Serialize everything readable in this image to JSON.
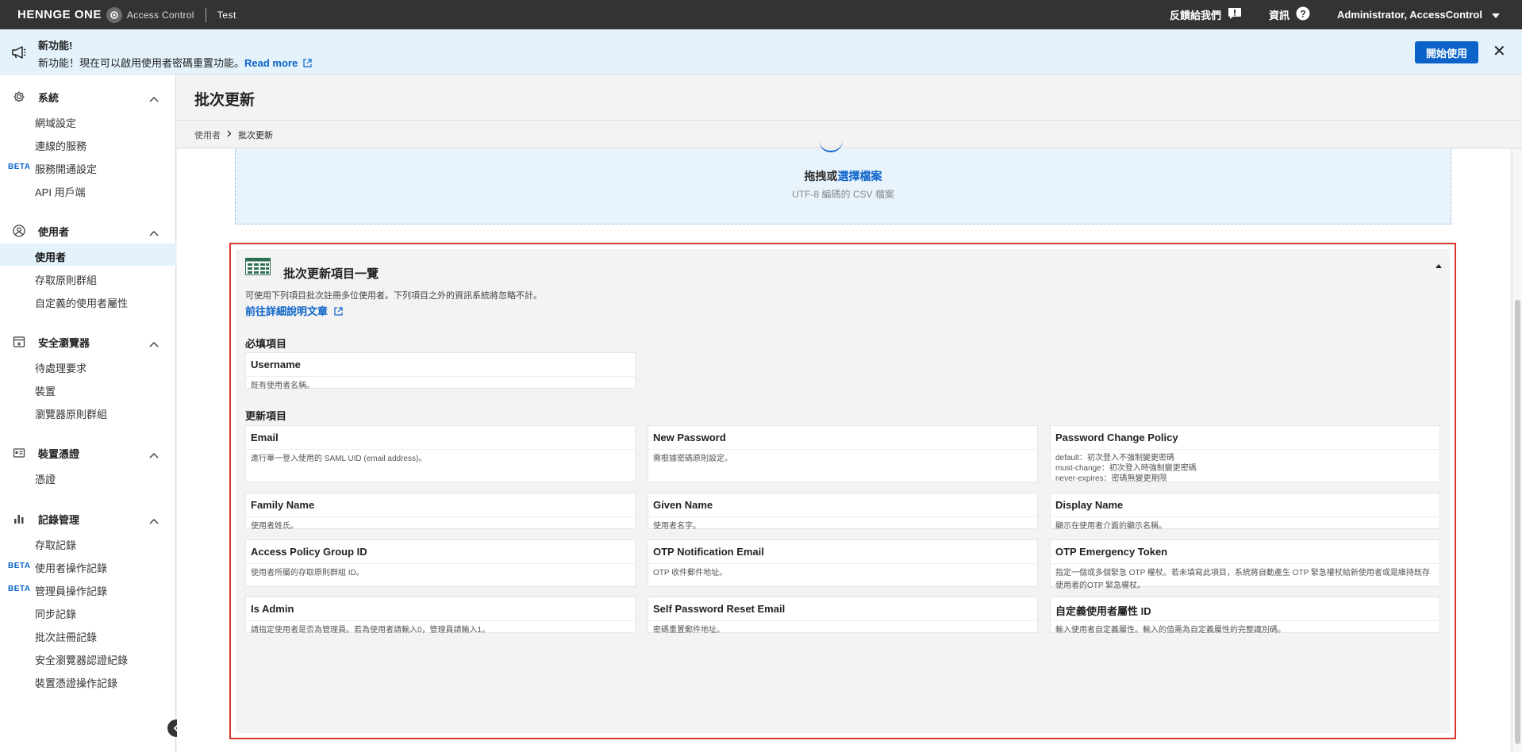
{
  "topbar": {
    "brand": "HENNGE ONE",
    "product": "Access Control",
    "tenant": "Test",
    "feedback": "反饋給我們",
    "info": "資訊",
    "user": "Administrator, AccessControl"
  },
  "banner": {
    "title": "新功能!",
    "text": "新功能！現在可以啟用使用者密碼重置功能。",
    "link": "Read more",
    "start_button": "開始使用"
  },
  "sidebar": {
    "beta": "BETA",
    "sections": [
      {
        "label": "系統",
        "items": [
          "網域設定",
          "連線的服務",
          "服務開通設定",
          "API 用戶端"
        ]
      },
      {
        "label": "使用者",
        "items": [
          "使用者",
          "存取原則群組",
          "自定義的使用者屬性"
        ]
      },
      {
        "label": "安全瀏覽器",
        "items": [
          "待處理要求",
          "裝置",
          "瀏覽器原則群組"
        ]
      },
      {
        "label": "裝置憑證",
        "items": [
          "憑證"
        ]
      },
      {
        "label": "記錄管理",
        "items": [
          "存取記錄",
          "使用者操作記錄",
          "管理員操作記錄",
          "同步記錄",
          "批次註冊記錄",
          "安全瀏覽器認證紀錄",
          "裝置憑證操作記錄"
        ]
      }
    ]
  },
  "page": {
    "title": "批次更新",
    "breadcrumb": [
      "使用者",
      "批次更新"
    ]
  },
  "dropzone": {
    "text_prefix": "拖拽或",
    "text_link": "選擇檔案",
    "sub": "UTF-8 編碼的 CSV 檔案"
  },
  "item_list": {
    "title": "批次更新項目一覽",
    "description": "可使用下列項目批次註冊多位使用者。下列項目之外的資訊系統將忽略不計。",
    "link": "前往詳細說明文章",
    "required_title": "必填項目",
    "update_title": "更新項目",
    "required": [
      {
        "name": "Username",
        "desc": "既有使用者名稱。"
      }
    ],
    "update": [
      {
        "name": "Email",
        "desc": "進行單一登入使用的 SAML UID (email address)。"
      },
      {
        "name": "New Password",
        "desc": "需根據密碼原則設定。"
      },
      {
        "name": "Password Change Policy",
        "desc": "default：初次登入不強制變更密碼\nmust-change：初次登入時強制變更密碼\nnever-expires：密碼無變更期限"
      },
      {
        "name": "Family Name",
        "desc": "使用者姓氏。"
      },
      {
        "name": "Given Name",
        "desc": "使用者名字。"
      },
      {
        "name": "Display Name",
        "desc": "顯示在使用者介面的顯示名稱。"
      },
      {
        "name": "Access Policy Group ID",
        "desc": "使用者所屬的存取原則群組 ID。"
      },
      {
        "name": "OTP Notification Email",
        "desc": "OTP 收件郵件地址。"
      },
      {
        "name": "OTP Emergency Token",
        "desc": "指定一個或多個緊急 OTP 權杖。若未填寫此項目，系統將自動產生 OTP 緊急權杖給新使用者或是維持既存使用者的OTP 緊急權杖。"
      },
      {
        "name": "Is Admin",
        "desc": "請指定使用者是否為管理員。若為使用者請輸入0，管理員請輸入1。"
      },
      {
        "name": "Self Password Reset Email",
        "desc": "密碼重置郵件地址。"
      },
      {
        "name": "自定義使用者屬性 ID",
        "desc": "輸入使用者自定義屬性。輸入的值需為自定義屬性的完整識別碼。"
      }
    ]
  }
}
